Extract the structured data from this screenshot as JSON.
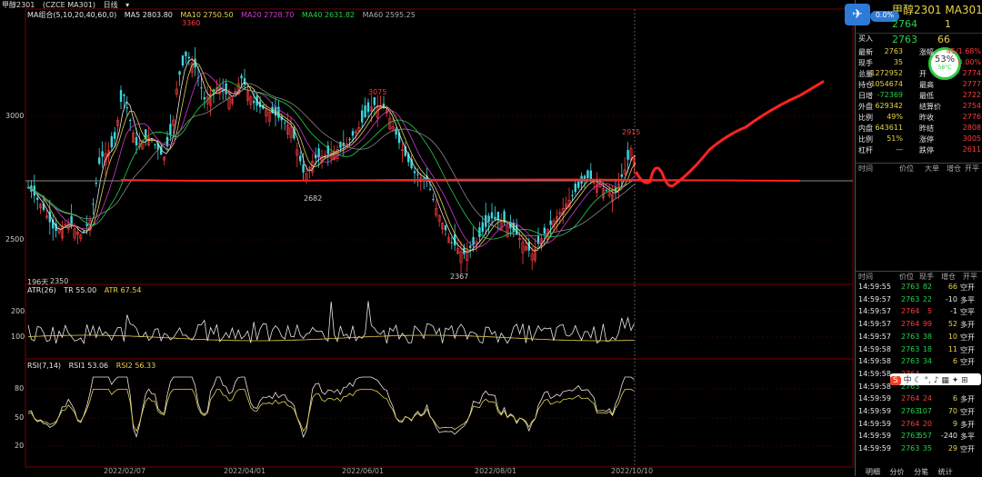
{
  "topbar": {
    "symbol": "甲醇2301",
    "code": "(CZCE MA301)",
    "period": "日线"
  },
  "ma_legend": {
    "label": "MA组合(5,10,20,40,60,0)",
    "ma5": "MA5 2803.80",
    "ma10": "MA10 2750.50",
    "ma20": "MA20 2728.70",
    "ma40": "MA40 2631.82",
    "ma60": "MA60 2595.25"
  },
  "atr_legend": {
    "label": "ATR(26)",
    "tr": "TR 55.00",
    "atr": "ATR 67.54"
  },
  "rsi_legend": {
    "label": "RSI(7,14)",
    "rsi1": "RSI1 53.06",
    "rsi2": "RSI2 56.33"
  },
  "y_main": [
    "3000",
    "2500"
  ],
  "y_atr": [
    "200",
    "100"
  ],
  "y_rsi": [
    "80",
    "50",
    "20"
  ],
  "x_dates": [
    "2022/02/07",
    "2022/04/01",
    "2022/06/01",
    "2022/08/01",
    "2022/10/10"
  ],
  "annotations": {
    "high1": "3360",
    "high2": "3075",
    "high3": "2915",
    "low1": "2350",
    "low2": "2682",
    "low3": "2367",
    "days": "196天"
  },
  "panel": {
    "title": "甲醇2301 MA301",
    "weibo_badge": "0.0%",
    "row1_left": "2764",
    "row1_right": "1",
    "buy_label": "买入",
    "buy_price": "2763",
    "buy_qty": "66",
    "gauge_pct": "53%",
    "gauge_temp": "58°C",
    "stats": [
      {
        "l": "最新",
        "v": "2763",
        "l2": "涨幅",
        "v2": "45/1.68%"
      },
      {
        "l": "现手",
        "v": "35",
        "l2": "",
        "v2": "0.00%"
      },
      {
        "l": "总量",
        "v": "1272952",
        "l2": "开",
        "v2": "2774"
      },
      {
        "l": "持仓",
        "v": "1054674",
        "l2": "最高",
        "v2": "2777"
      },
      {
        "l": "日增",
        "v": "-72369",
        "l2": "最低",
        "v2": "2722"
      },
      {
        "l": "外盘",
        "v": "629342",
        "l2": "结算价",
        "v2": "2754"
      },
      {
        "l": "比例",
        "v": "49%",
        "l2": "昨收",
        "v2": "2776"
      },
      {
        "l": "内盘",
        "v": "643611",
        "l2": "昨结",
        "v2": "2808"
      },
      {
        "l": "比例",
        "v": "51%",
        "l2": "涨停",
        "v2": "3005"
      },
      {
        "l": "杠杆",
        "v": "—",
        "l2": "跌停",
        "v2": "2611"
      }
    ],
    "hdr1": {
      "t": "时间",
      "p": "价位",
      "a": "大单",
      "b": "增仓",
      "c": "开平"
    },
    "hdr2": {
      "t": "时间",
      "p": "价位",
      "a": "现手",
      "b": "增仓",
      "c": "开平"
    },
    "ticks": [
      {
        "t": "14:59:55",
        "p": "2763",
        "q": "82",
        "d": "66",
        "o": "空开"
      },
      {
        "t": "14:59:57",
        "p": "2763",
        "q": "22",
        "d": "-10",
        "o": "多平"
      },
      {
        "t": "14:59:57",
        "p": "2764",
        "q": "5",
        "d": "-1",
        "o": "空平"
      },
      {
        "t": "14:59:57",
        "p": "2764",
        "q": "99",
        "d": "52",
        "o": "多开"
      },
      {
        "t": "14:59:57",
        "p": "2763",
        "q": "38",
        "d": "10",
        "o": "空开"
      },
      {
        "t": "14:59:58",
        "p": "2763",
        "q": "18",
        "d": "11",
        "o": "空开"
      },
      {
        "t": "14:59:58",
        "p": "2763",
        "q": "34",
        "d": "6",
        "o": "空开"
      },
      {
        "t": "14:59:58",
        "p": "2764",
        "q": "",
        "d": "",
        "o": ""
      },
      {
        "t": "14:59:58",
        "p": "2763",
        "q": "",
        "d": "",
        "o": ""
      },
      {
        "t": "14:59:59",
        "p": "2764",
        "q": "24",
        "d": "6",
        "o": "多开"
      },
      {
        "t": "14:59:59",
        "p": "2763",
        "q": "107",
        "d": "70",
        "o": "空开"
      },
      {
        "t": "14:59:59",
        "p": "2764",
        "q": "20",
        "d": "9",
        "o": "多开"
      },
      {
        "t": "14:59:59",
        "p": "2763",
        "q": "557",
        "d": "-240",
        "o": "多平"
      },
      {
        "t": "14:59:59",
        "p": "2763",
        "q": "35",
        "d": "29",
        "o": "空开"
      }
    ],
    "ime": {
      "logo": "S",
      "lang": "中"
    },
    "tabs": [
      "明细",
      "分价",
      "分笔",
      "统计"
    ]
  }
}
